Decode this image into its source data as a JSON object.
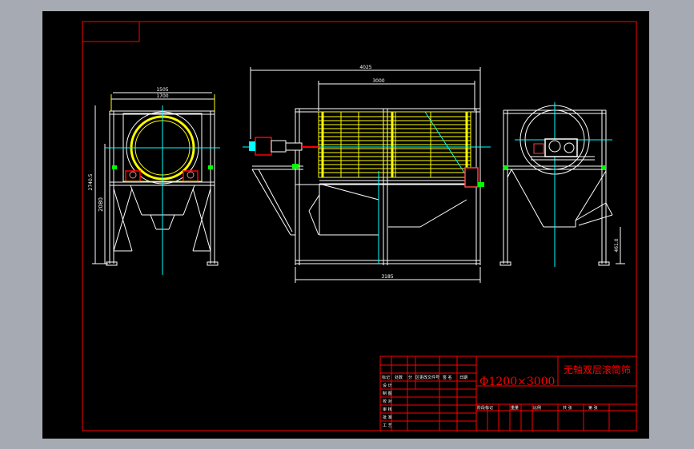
{
  "drawing": {
    "title": "无轴双层滚筒筛",
    "spec": "Φ1200×3000"
  },
  "dimensions": {
    "left_width_outer": "1505",
    "left_width_inner": "1700",
    "left_height_total": "2740.5",
    "left_height_lower": "2080",
    "front_total_length": "4025",
    "front_drum_length": "3000",
    "front_base_length": "3185",
    "right_height": "461.0"
  },
  "title_block": {
    "header_cells": [
      "标记",
      "处数",
      "分",
      "区更改文件号",
      "签 名",
      "日期"
    ],
    "left_rows": [
      "设 计",
      "制 图",
      "校 对",
      "审 核",
      "批 准",
      "工 艺"
    ],
    "bottom_cells": [
      "阶段标记",
      "重量",
      "比例",
      "共 张",
      "第 张"
    ]
  },
  "colors": {
    "frame": "#ff0000",
    "outline": "#ffffff",
    "drum": "#ffff00",
    "center": "#00ffff",
    "joint": "#00ff00",
    "motor": "#ff0000"
  }
}
